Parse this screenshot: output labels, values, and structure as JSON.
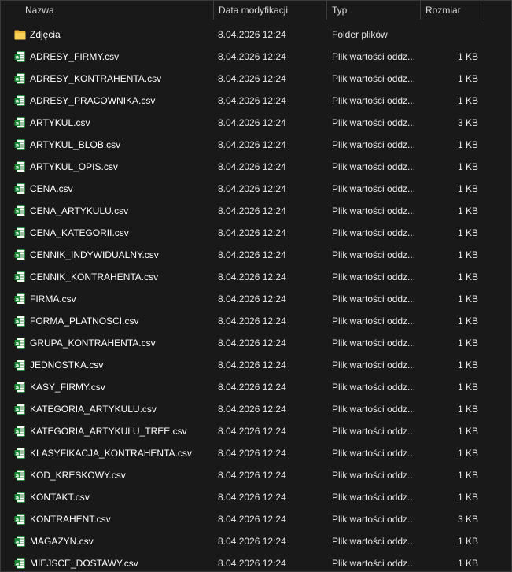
{
  "columns": {
    "name": "Nazwa",
    "date": "Data modyfikacji",
    "type": "Typ",
    "size": "Rozmiar"
  },
  "colors": {
    "background": "#191919",
    "folder": "#f5c541",
    "csv_icon": "#3aa84a",
    "text": "#ffffff"
  },
  "files": [
    {
      "name": "Zdjęcia",
      "date": "8.04.2026 12:24",
      "type": "Folder plików",
      "size": "",
      "icon": "folder-icon"
    },
    {
      "name": "ADRESY_FIRMY.csv",
      "date": "8.04.2026 12:24",
      "type": "Plik wartości oddz...",
      "size": "1 KB",
      "icon": "csv-file-icon"
    },
    {
      "name": "ADRESY_KONTRAHENTA.csv",
      "date": "8.04.2026 12:24",
      "type": "Plik wartości oddz...",
      "size": "1 KB",
      "icon": "csv-file-icon"
    },
    {
      "name": "ADRESY_PRACOWNIKA.csv",
      "date": "8.04.2026 12:24",
      "type": "Plik wartości oddz...",
      "size": "1 KB",
      "icon": "csv-file-icon"
    },
    {
      "name": "ARTYKUL.csv",
      "date": "8.04.2026 12:24",
      "type": "Plik wartości oddz...",
      "size": "3 KB",
      "icon": "csv-file-icon"
    },
    {
      "name": "ARTYKUL_BLOB.csv",
      "date": "8.04.2026 12:24",
      "type": "Plik wartości oddz...",
      "size": "1 KB",
      "icon": "csv-file-icon"
    },
    {
      "name": "ARTYKUL_OPIS.csv",
      "date": "8.04.2026 12:24",
      "type": "Plik wartości oddz...",
      "size": "1 KB",
      "icon": "csv-file-icon"
    },
    {
      "name": "CENA.csv",
      "date": "8.04.2026 12:24",
      "type": "Plik wartości oddz...",
      "size": "1 KB",
      "icon": "csv-file-icon"
    },
    {
      "name": "CENA_ARTYKULU.csv",
      "date": "8.04.2026 12:24",
      "type": "Plik wartości oddz...",
      "size": "1 KB",
      "icon": "csv-file-icon"
    },
    {
      "name": "CENA_KATEGORII.csv",
      "date": "8.04.2026 12:24",
      "type": "Plik wartości oddz...",
      "size": "1 KB",
      "icon": "csv-file-icon"
    },
    {
      "name": "CENNIK_INDYWIDUALNY.csv",
      "date": "8.04.2026 12:24",
      "type": "Plik wartości oddz...",
      "size": "1 KB",
      "icon": "csv-file-icon"
    },
    {
      "name": "CENNIK_KONTRAHENTA.csv",
      "date": "8.04.2026 12:24",
      "type": "Plik wartości oddz...",
      "size": "1 KB",
      "icon": "csv-file-icon"
    },
    {
      "name": "FIRMA.csv",
      "date": "8.04.2026 12:24",
      "type": "Plik wartości oddz...",
      "size": "1 KB",
      "icon": "csv-file-icon"
    },
    {
      "name": "FORMA_PLATNOSCI.csv",
      "date": "8.04.2026 12:24",
      "type": "Plik wartości oddz...",
      "size": "1 KB",
      "icon": "csv-file-icon"
    },
    {
      "name": "GRUPA_KONTRAHENTA.csv",
      "date": "8.04.2026 12:24",
      "type": "Plik wartości oddz...",
      "size": "1 KB",
      "icon": "csv-file-icon"
    },
    {
      "name": "JEDNOSTKA.csv",
      "date": "8.04.2026 12:24",
      "type": "Plik wartości oddz...",
      "size": "1 KB",
      "icon": "csv-file-icon"
    },
    {
      "name": "KASY_FIRMY.csv",
      "date": "8.04.2026 12:24",
      "type": "Plik wartości oddz...",
      "size": "1 KB",
      "icon": "csv-file-icon"
    },
    {
      "name": "KATEGORIA_ARTYKULU.csv",
      "date": "8.04.2026 12:24",
      "type": "Plik wartości oddz...",
      "size": "1 KB",
      "icon": "csv-file-icon"
    },
    {
      "name": "KATEGORIA_ARTYKULU_TREE.csv",
      "date": "8.04.2026 12:24",
      "type": "Plik wartości oddz...",
      "size": "1 KB",
      "icon": "csv-file-icon"
    },
    {
      "name": "KLASYFIKACJA_KONTRAHENTA.csv",
      "date": "8.04.2026 12:24",
      "type": "Plik wartości oddz...",
      "size": "1 KB",
      "icon": "csv-file-icon"
    },
    {
      "name": "KOD_KRESKOWY.csv",
      "date": "8.04.2026 12:24",
      "type": "Plik wartości oddz...",
      "size": "1 KB",
      "icon": "csv-file-icon"
    },
    {
      "name": "KONTAKT.csv",
      "date": "8.04.2026 12:24",
      "type": "Plik wartości oddz...",
      "size": "1 KB",
      "icon": "csv-file-icon"
    },
    {
      "name": "KONTRAHENT.csv",
      "date": "8.04.2026 12:24",
      "type": "Plik wartości oddz...",
      "size": "3 KB",
      "icon": "csv-file-icon"
    },
    {
      "name": "MAGAZYN.csv",
      "date": "8.04.2026 12:24",
      "type": "Plik wartości oddz...",
      "size": "1 KB",
      "icon": "csv-file-icon"
    },
    {
      "name": "MIEJSCE_DOSTAWY.csv",
      "date": "8.04.2026 12:24",
      "type": "Plik wartości oddz...",
      "size": "1 KB",
      "icon": "csv-file-icon"
    }
  ]
}
